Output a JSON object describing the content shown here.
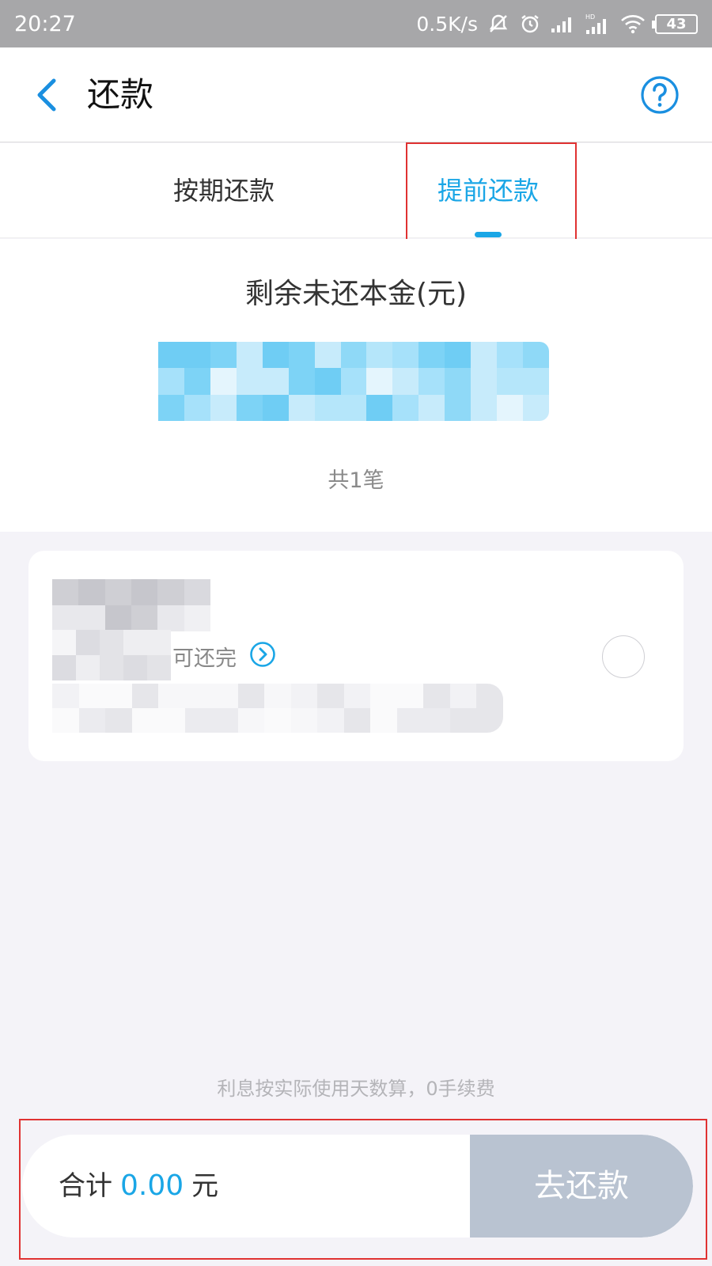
{
  "status_bar": {
    "time": "20:27",
    "network_speed": "0.5K/s",
    "battery": "43",
    "icons": [
      "mute-icon",
      "alarm-icon",
      "signal-icon",
      "hd-signal-icon",
      "wifi-icon",
      "battery-icon"
    ]
  },
  "header": {
    "title": "还款",
    "back_icon": "chevron-left-icon",
    "help_icon": "help-circle-icon"
  },
  "tabs": [
    {
      "label": "按期还款",
      "active": false
    },
    {
      "label": "提前还款",
      "active": true
    }
  ],
  "summary": {
    "title": "剩余未还本金(元)",
    "count": "共1笔"
  },
  "loan_card": {
    "payoff_text": "可还完",
    "link_icon": "chevron-right-circle-icon",
    "selected": false
  },
  "footnote": "利息按实际使用天数算，0手续费",
  "bottom_bar": {
    "total_prefix": "合计",
    "total_amount": "0.00",
    "total_unit": "元",
    "repay_button": "去还款"
  },
  "colors": {
    "accent": "#1aa6e6",
    "button_disabled": "#b9c3d1",
    "highlight": "#e03232",
    "background": "#f4f3f8"
  }
}
